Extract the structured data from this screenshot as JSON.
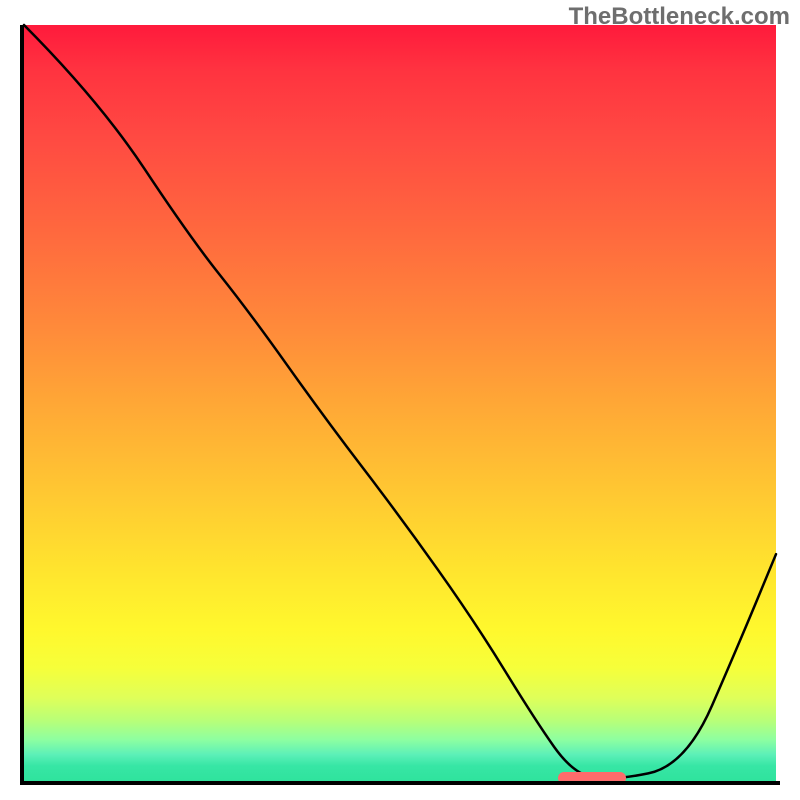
{
  "watermark": "TheBottleneck.com",
  "chart_data": {
    "type": "line",
    "title": "",
    "xlabel": "",
    "ylabel": "",
    "xlim": [
      0,
      100
    ],
    "ylim": [
      0,
      100
    ],
    "x": [
      0,
      10,
      22,
      30,
      40,
      50,
      60,
      68,
      73,
      78,
      88,
      95,
      100
    ],
    "y": [
      100,
      90,
      72,
      62,
      48,
      35,
      21,
      8,
      1,
      0,
      2,
      18,
      30
    ],
    "marker": {
      "x_start": 71,
      "x_end": 80,
      "y": 0
    },
    "gradient_stops": [
      {
        "pos": 0,
        "color": "#ff1a3c"
      },
      {
        "pos": 6,
        "color": "#ff3340"
      },
      {
        "pos": 15,
        "color": "#ff4a42"
      },
      {
        "pos": 28,
        "color": "#ff6a3e"
      },
      {
        "pos": 40,
        "color": "#ff8a3a"
      },
      {
        "pos": 50,
        "color": "#ffa736"
      },
      {
        "pos": 62,
        "color": "#ffc832"
      },
      {
        "pos": 72,
        "color": "#ffe42e"
      },
      {
        "pos": 80,
        "color": "#fff82d"
      },
      {
        "pos": 85,
        "color": "#f6ff3a"
      },
      {
        "pos": 89,
        "color": "#dfff59"
      },
      {
        "pos": 92,
        "color": "#b8ff78"
      },
      {
        "pos": 94.5,
        "color": "#8effa0"
      },
      {
        "pos": 96.5,
        "color": "#5cf0b8"
      },
      {
        "pos": 98,
        "color": "#37e6a5"
      },
      {
        "pos": 100,
        "color": "#2fe39d"
      }
    ]
  }
}
